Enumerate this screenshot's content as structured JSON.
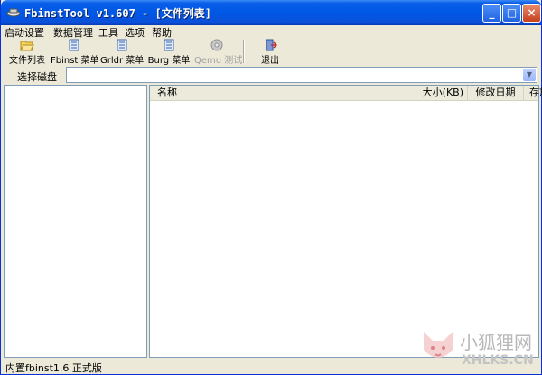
{
  "window": {
    "title": "FbinstTool v1.607 - [文件列表]"
  },
  "menu": [
    "启动设置",
    "数据管理",
    "工具",
    "选项",
    "帮助"
  ],
  "toolbar": {
    "file_list": "文件列表",
    "fbinst_menu": "Fbinst 菜单",
    "grldr_menu": "Grldr 菜单",
    "burg_menu": "Burg 菜单",
    "qemu_test": "Qemu 测试",
    "exit": "退出"
  },
  "disk": {
    "label": "选择磁盘",
    "value": ""
  },
  "filelist": {
    "columns": {
      "name": "名称",
      "size": "大小(KB)",
      "date": "修改日期",
      "area": "存放区域"
    },
    "rows": []
  },
  "status": {
    "text": "内置fbinst1.6 正式版"
  },
  "watermark": {
    "name": "小狐狸网",
    "url": "XHLKS.CN"
  },
  "colors": {
    "titlebar": "#0058e6",
    "frame": "#ece9d8",
    "header": "#ebeadb",
    "disabled_text": "#a0a0a0"
  }
}
